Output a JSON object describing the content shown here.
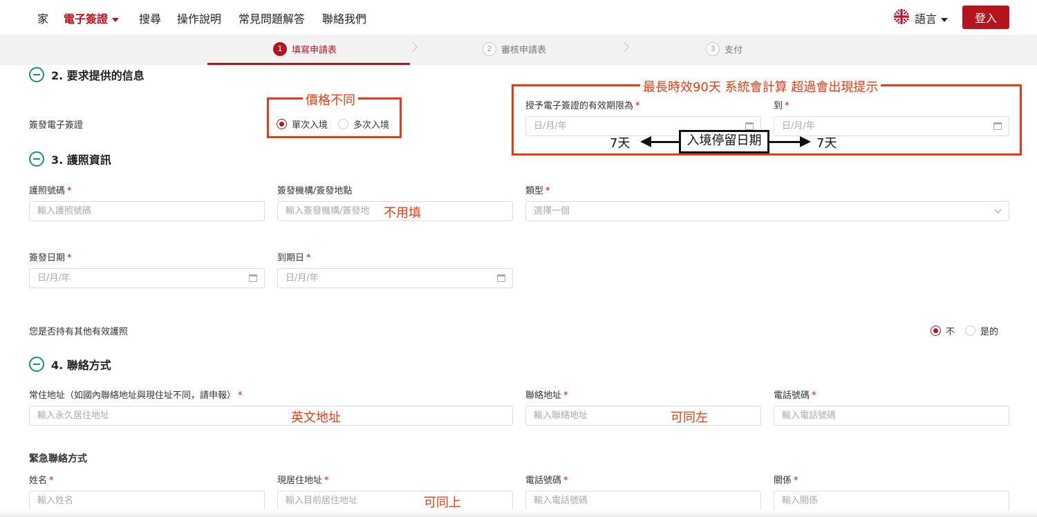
{
  "nav": {
    "home": "家",
    "evisa": "電子簽證",
    "search": "搜尋",
    "instructions": "操作說明",
    "faq": "常見問題解答",
    "contact": "聯絡我們",
    "language": "語言",
    "login": "登入"
  },
  "stepper": {
    "steps": [
      {
        "num": "1",
        "label": "填寫申請表"
      },
      {
        "num": "2",
        "label": "審核申請表"
      },
      {
        "num": "3",
        "label": "支付"
      }
    ]
  },
  "section2": {
    "title": "2. 要求提供的信息",
    "visa_label": "簽發電子簽證",
    "single_entry": "單次入境",
    "multi_entry": "多次入境",
    "validity_label": "授予電子簽證的有效期限為",
    "to_label": "到",
    "date_placeholder": "日/月/年"
  },
  "section3": {
    "title": "3. 護照資訊",
    "passport_no_label": "護照號碼",
    "passport_no_placeholder": "輸入護照號碼",
    "issuer_label": "簽發機構/簽發地點",
    "issuer_placeholder": "輸入簽發機構/簽發地",
    "type_label": "類型",
    "type_placeholder": "選擇一個",
    "issue_date_label": "簽發日期",
    "expiry_label": "到期日",
    "date_placeholder": "日/月/年",
    "other_passport_label": "您是否持有其他有效護照",
    "no": "不",
    "yes": "是的"
  },
  "section4": {
    "title": "4. 聯絡方式",
    "permanent_label": "常住地址（如國內聯絡地址與現住址不同，請申報）",
    "permanent_placeholder": "輸入永久居住地址",
    "contact_addr_label": "聯絡地址",
    "contact_addr_placeholder": "輸入聯絡地址",
    "phone_label": "電話號碼",
    "phone_placeholder": "輸入電話號碼",
    "emergency_title": "緊急聯絡方式",
    "name_label": "姓名",
    "name_placeholder": "輸入姓名",
    "current_addr_label": "現居住地址",
    "current_addr_placeholder": "輸入目前居住地址",
    "e_phone_label": "電話號碼",
    "e_phone_placeholder": "輸入電話號碼",
    "relation_label": "關係",
    "relation_placeholder": "輸入關係"
  },
  "annotations": {
    "price": "價格不同",
    "max_validity": "最長時效90天 系統會計算 超過會出現提示",
    "stay_dates": "入境停留日期",
    "seven_days_left": "7天",
    "seven_days_right": "7天",
    "no_fill": "不用填",
    "english_address": "英文地址",
    "same_as_left": "可同左",
    "same_as_above": "可同上"
  },
  "colors": {
    "brand": "#b3141e",
    "accent_teal": "#1b8c7e",
    "annotation": "#e63a14"
  }
}
